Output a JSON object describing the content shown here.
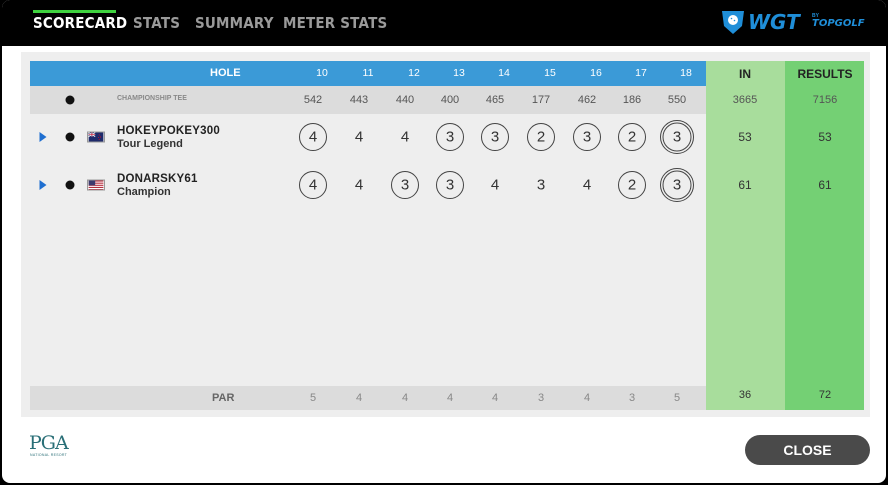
{
  "tabs": [
    {
      "label": "SCORECARD",
      "active": true
    },
    {
      "label": "STATS",
      "active": false
    },
    {
      "label": "SUMMARY",
      "active": false
    },
    {
      "label": "METER STATS",
      "active": false
    }
  ],
  "brand": {
    "logo": "WGT",
    "by": "BY",
    "sub": "TOPGOLF",
    "color": "#1f8ed8"
  },
  "scorecard": {
    "hole_label": "HOLE",
    "holes": [
      "10",
      "11",
      "12",
      "13",
      "14",
      "15",
      "16",
      "17",
      "18"
    ],
    "in_label": "IN",
    "results_label": "RESULTS",
    "tee": {
      "label": "CHAMPIONSHIP TEE",
      "yardages": [
        "542",
        "443",
        "440",
        "400",
        "465",
        "177",
        "462",
        "186",
        "550"
      ],
      "in": "3665",
      "results": "7156"
    },
    "players": [
      {
        "name": "HOKEYPOKEY300",
        "title": "Tour Legend",
        "flag": "new-zealand-flag",
        "scores": [
          "4",
          "4",
          "4",
          "3",
          "3",
          "2",
          "3",
          "2",
          "3"
        ],
        "rings": [
          1,
          0,
          0,
          1,
          1,
          1,
          1,
          1,
          2
        ],
        "in": "53",
        "results": "53"
      },
      {
        "name": "DONARSKY61",
        "title": "Champion",
        "flag": "usa-flag",
        "scores": [
          "4",
          "4",
          "3",
          "3",
          "4",
          "3",
          "4",
          "2",
          "3"
        ],
        "rings": [
          1,
          0,
          1,
          1,
          0,
          0,
          0,
          1,
          2
        ],
        "in": "61",
        "results": "61"
      }
    ],
    "par": {
      "label": "PAR",
      "values": [
        "5",
        "4",
        "4",
        "4",
        "4",
        "3",
        "4",
        "3",
        "5"
      ],
      "in": "36",
      "results": "72"
    }
  },
  "footer": {
    "pga_logo": "PGA",
    "pga_sub": "NATIONAL RESORT",
    "close_label": "CLOSE"
  },
  "colors": {
    "header_blue": "#3b9ad7",
    "in_column": "#a8dd9c",
    "results_column": "#74d074",
    "tab_underline": "#3fd33f"
  }
}
